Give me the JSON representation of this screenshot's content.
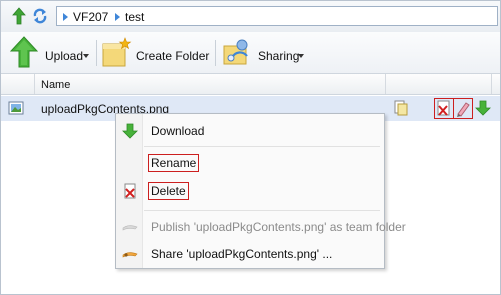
{
  "nav": {
    "path": [
      "VF207",
      "test"
    ]
  },
  "toolbar": {
    "upload_label": "Upload",
    "create_folder_label": "Create Folder",
    "sharing_label": "Sharing"
  },
  "grid": {
    "column_name": "Name",
    "row": {
      "file_name": "uploadPkgContents.png"
    }
  },
  "context_menu": {
    "items": [
      {
        "label": "Download",
        "enabled": true,
        "icon": "download-arrow-icon"
      },
      {
        "label": "Rename",
        "enabled": true,
        "highlighted": true
      },
      {
        "label": "Delete",
        "enabled": true,
        "icon": "delete-icon",
        "highlighted": true
      },
      {
        "label": "Publish 'uploadPkgContents.png' as team folder",
        "enabled": false,
        "icon": "publish-icon"
      },
      {
        "label": "Share 'uploadPkgContents.png' ...",
        "enabled": true,
        "icon": "share-icon"
      }
    ]
  },
  "colors": {
    "selection": "#dfe8f6",
    "highlight_box": "#cc1f1f",
    "accent_green": "#3fa535"
  }
}
